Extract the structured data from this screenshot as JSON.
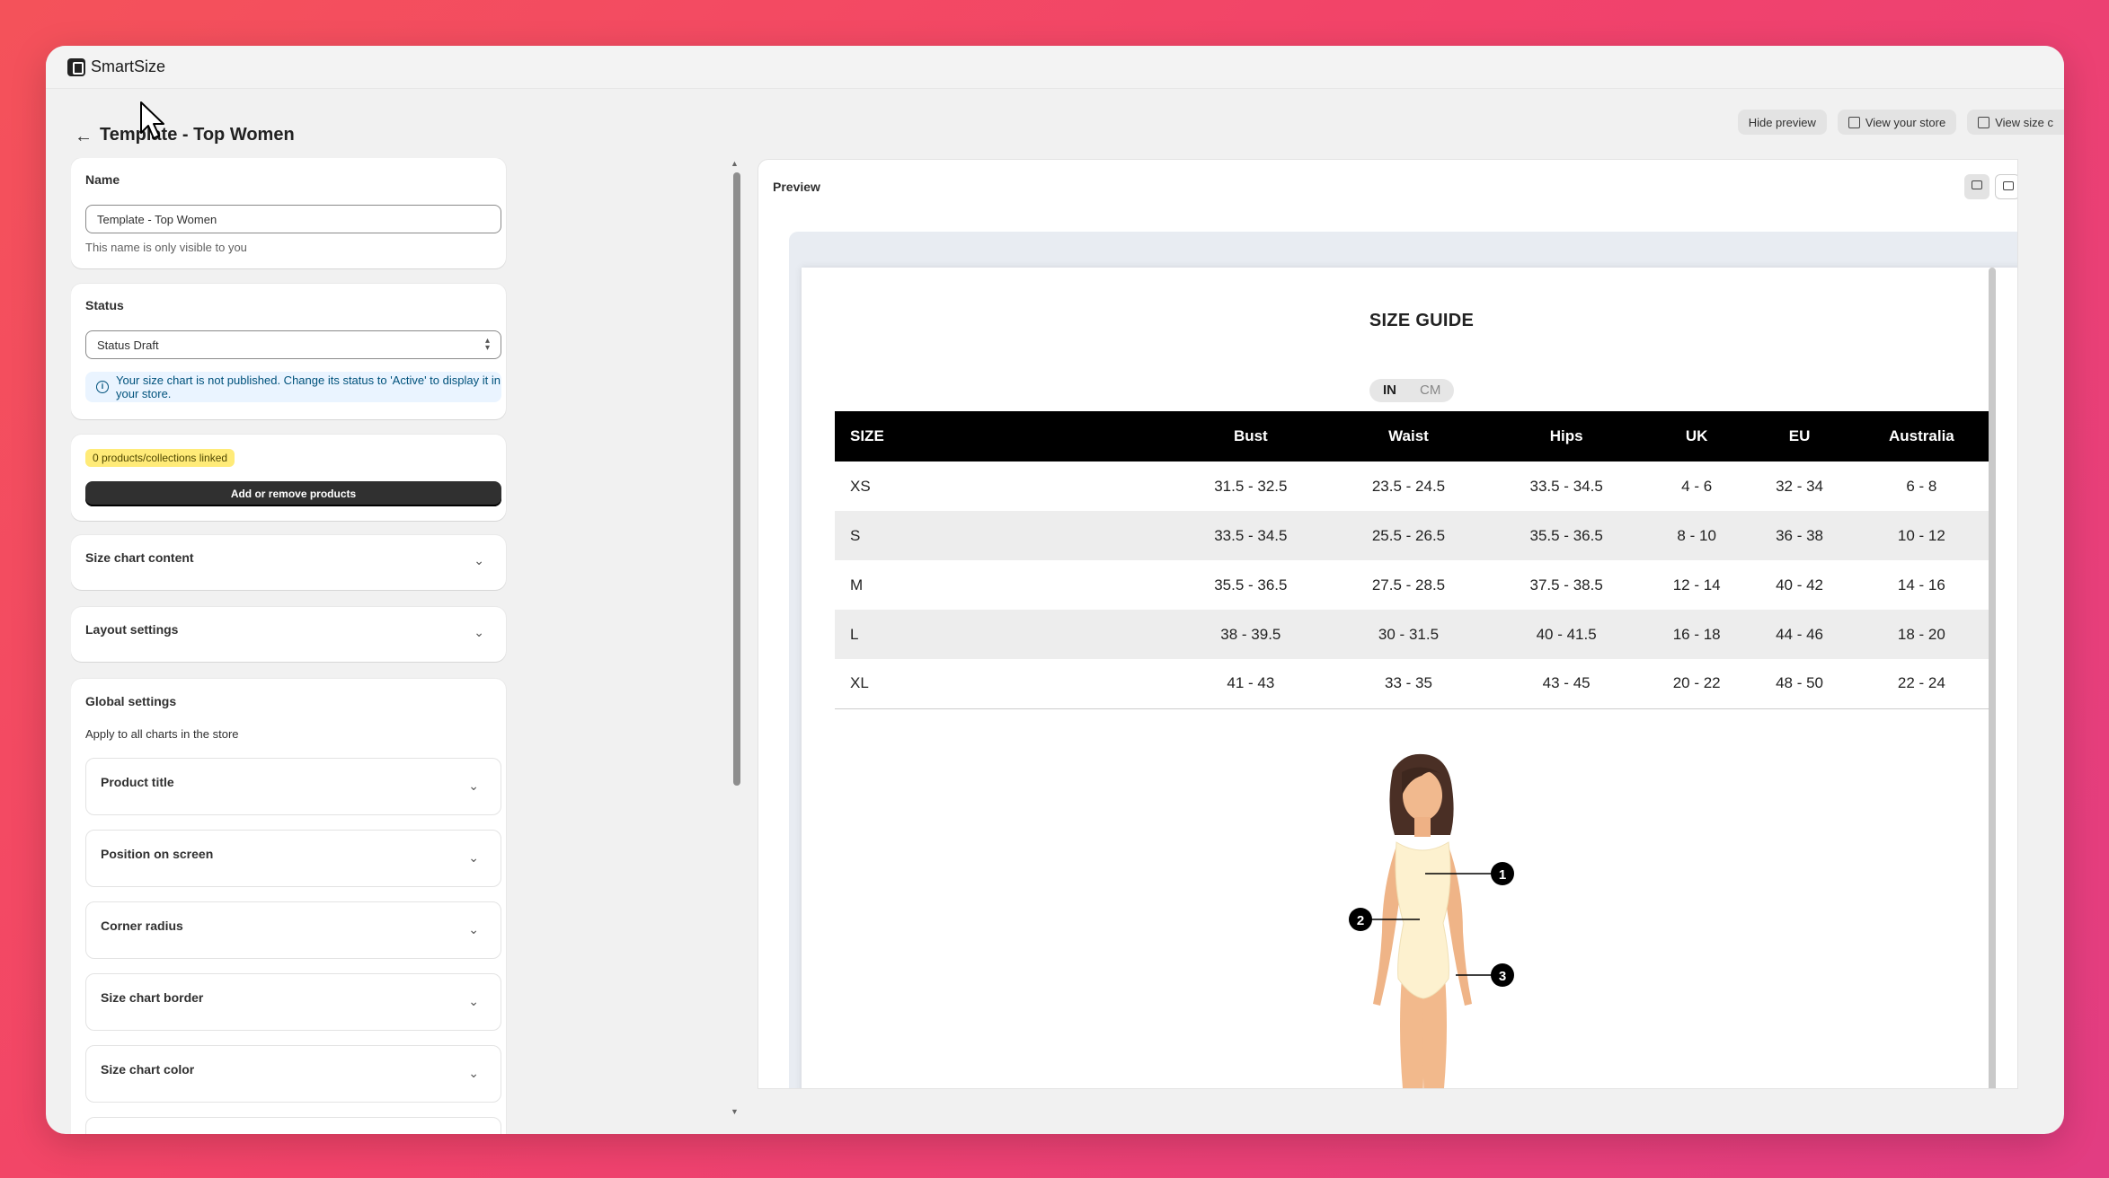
{
  "app": {
    "name": "SmartSize"
  },
  "header": {
    "title": "Template - Top Women",
    "actions": {
      "hide_preview": "Hide preview",
      "view_store": "View your store",
      "view_size": "View size c"
    }
  },
  "name_card": {
    "label": "Name",
    "value": "Template - Top Women",
    "help": "This name is only visible to you"
  },
  "status_card": {
    "label": "Status",
    "value": "Status Draft",
    "banner": "Your size chart is not published. Change its status to 'Active' to display it in your store."
  },
  "products_card": {
    "badge": "0 products/collections linked",
    "button": "Add or remove products"
  },
  "sections": {
    "size_chart_content": "Size chart content",
    "layout_settings": "Layout settings"
  },
  "global_settings": {
    "title": "Global settings",
    "subtitle": "Apply to all charts in the store",
    "items": [
      "Product title",
      "Position on screen",
      "Corner radius",
      "Size chart border",
      "Size chart color"
    ]
  },
  "preview": {
    "label": "Preview",
    "guide_title": "SIZE GUIDE",
    "units": [
      "IN",
      "CM"
    ],
    "active_unit": "IN",
    "columns": [
      "SIZE",
      "Bust",
      "Waist",
      "Hips",
      "UK",
      "EU",
      "Australia"
    ],
    "rows": [
      [
        "XS",
        "31.5 - 32.5",
        "23.5 - 24.5",
        "33.5 - 34.5",
        "4 - 6",
        "32 - 34",
        "6 - 8"
      ],
      [
        "S",
        "33.5 - 34.5",
        "25.5 - 26.5",
        "35.5 - 36.5",
        "8 - 10",
        "36 - 38",
        "10 - 12"
      ],
      [
        "M",
        "35.5 - 36.5",
        "27.5 - 28.5",
        "37.5 - 38.5",
        "12 - 14",
        "40 - 42",
        "14 - 16"
      ],
      [
        "L",
        "38 - 39.5",
        "30 - 31.5",
        "40 - 41.5",
        "16 - 18",
        "44 - 46",
        "18 - 20"
      ],
      [
        "XL",
        "41 - 43",
        "33 - 35",
        "43 - 45",
        "20 - 22",
        "48 - 50",
        "22 - 24"
      ]
    ],
    "markers": [
      "1",
      "2",
      "3"
    ]
  },
  "colors": {
    "background_start": "#f4525a",
    "background_end": "#e23d82",
    "table_header": "#000000",
    "badge": "#ffeb78"
  }
}
